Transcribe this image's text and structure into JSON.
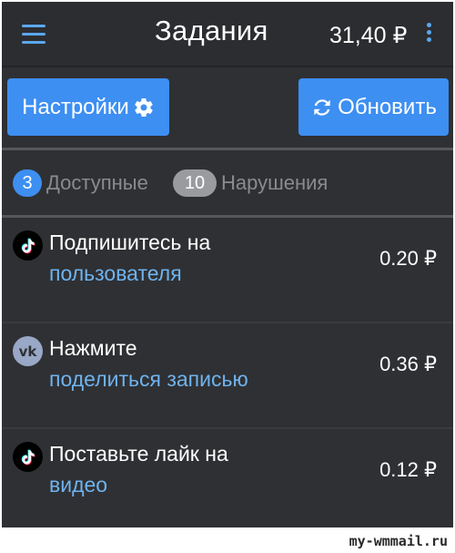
{
  "appbar": {
    "menu_icon": "hamburger-menu-icon",
    "title": "Задания",
    "balance": "31,40 ₽",
    "more_icon": "more-vertical-icon"
  },
  "actions": {
    "settings_label": "Настройки",
    "settings_icon": "gear-icon",
    "refresh_label": "Обновить",
    "refresh_icon": "refresh-icon"
  },
  "tabs": [
    {
      "count": "3",
      "label": "Доступные",
      "badge_color": "#3d8ff2"
    },
    {
      "count": "10",
      "label": "Нарушения",
      "badge_color": "#9a9b9e"
    }
  ],
  "tasks": [
    {
      "icon": "tiktok-icon",
      "title": "Подпишитесь на",
      "link": "пользователя",
      "price": "0.20 ₽"
    },
    {
      "icon": "vk-icon",
      "title": "Нажмите",
      "link": "поделиться записью",
      "price": "0.36 ₽"
    },
    {
      "icon": "tiktok-icon",
      "title": "Поставьте лайк на",
      "link": "видео",
      "price": "0.12 ₽"
    }
  ],
  "watermark": "my-wmmail.ru",
  "colors": {
    "accent": "#3d8ff2",
    "link": "#6fb3ee",
    "background": "#2f3033"
  }
}
